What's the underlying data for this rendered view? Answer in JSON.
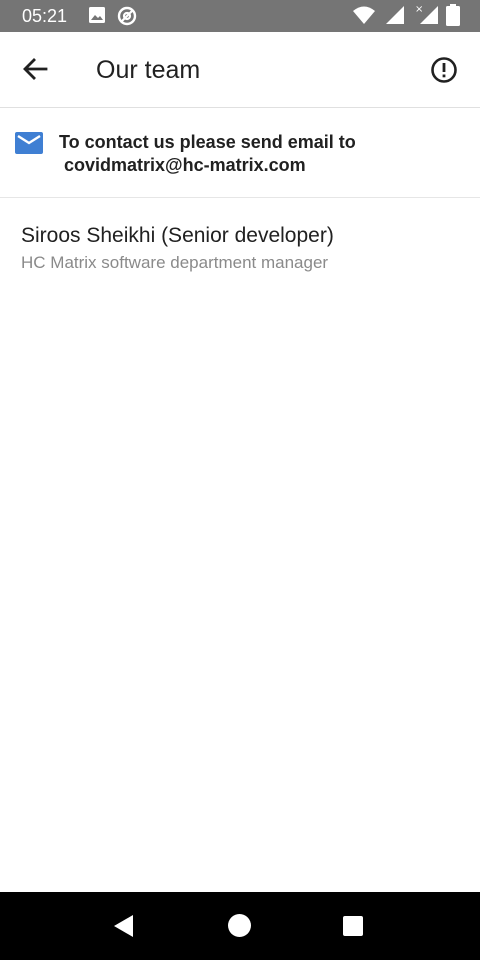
{
  "status_bar": {
    "time": "05:21",
    "icons": [
      "image-icon",
      "at-sign-icon",
      "wifi-icon",
      "signal-icon",
      "signal-no-data-icon",
      "battery-icon"
    ]
  },
  "app_bar": {
    "title": "Our team",
    "back_icon": "arrow-back-icon",
    "info_icon": "info-circle-icon"
  },
  "contact": {
    "icon": "mail-icon",
    "line1": "To contact us please send email to",
    "line2": "covidmatrix@hc-matrix.com",
    "accent_color": "#3f7fd3"
  },
  "team": [
    {
      "name": "Siroos Sheikhi (Senior developer)",
      "role": "HC Matrix software department manager"
    }
  ],
  "nav_bar": {
    "buttons": [
      "back-triangle-icon",
      "home-circle-icon",
      "recents-square-icon"
    ]
  },
  "colors": {
    "status_bar": "#757575",
    "nav_bar": "#000000",
    "primary_text": "#212121",
    "secondary_text": "#8a8a8a"
  }
}
